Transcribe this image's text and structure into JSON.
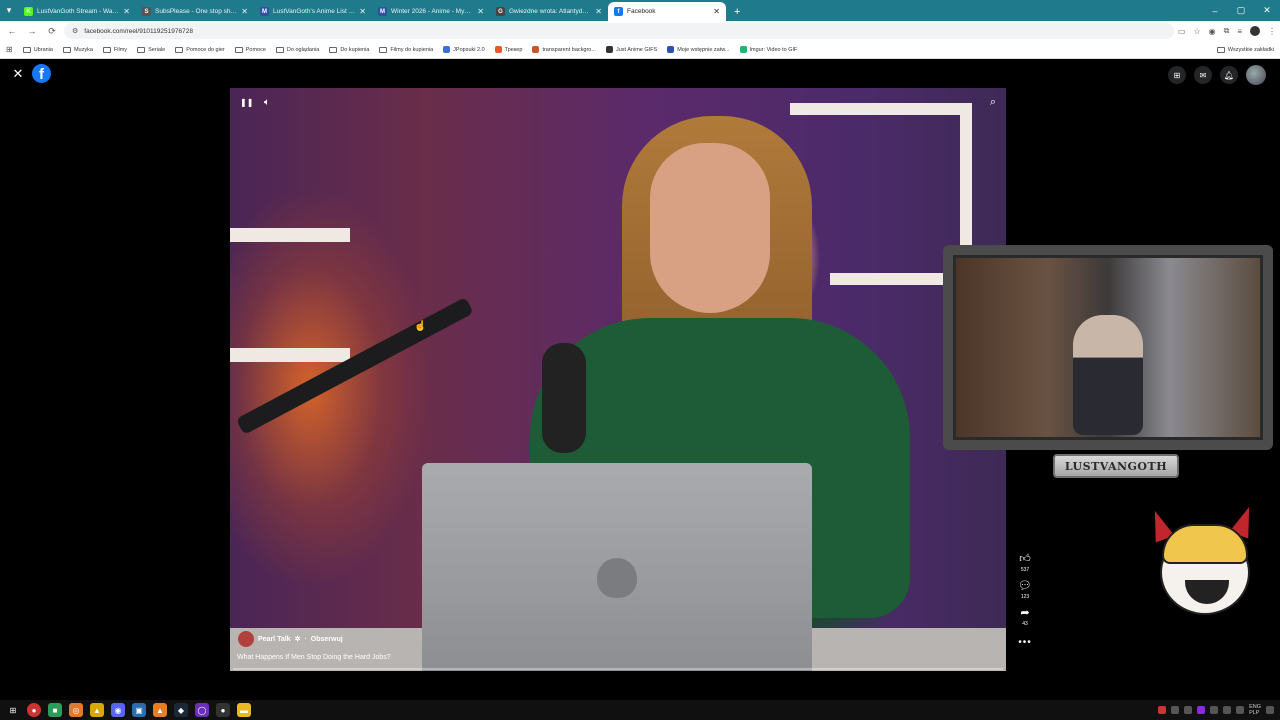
{
  "browser": {
    "tabs": [
      {
        "title": "LustVanGoth Stream - Watch L",
        "favicon_color": "#53fc18",
        "favicon_char": "K",
        "active": false
      },
      {
        "title": "SubsPlease - One stop shop fo",
        "favicon_color": "#555555",
        "favicon_char": "S",
        "active": false
      },
      {
        "title": "LustVanGoth's Anime List - My",
        "favicon_color": "#2e51a2",
        "favicon_char": "M",
        "active": false
      },
      {
        "title": "Winter 2026 - Anime - MyAnim",
        "favicon_color": "#2e51a2",
        "favicon_char": "M",
        "active": false
      },
      {
        "title": "Gwiezdne wrota: Atlantyda / St",
        "favicon_color": "#444444",
        "favicon_char": "G",
        "active": false
      },
      {
        "title": "Facebook",
        "favicon_color": "#1877f2",
        "favicon_char": "f",
        "active": true
      }
    ],
    "url": "facebook.com/reel/910119251976728",
    "bookmarks": [
      {
        "label": "Ubrania",
        "type": "folder"
      },
      {
        "label": "Muzyka",
        "type": "folder"
      },
      {
        "label": "Filmy",
        "type": "folder"
      },
      {
        "label": "Seriale",
        "type": "folder"
      },
      {
        "label": "Pomoce do gier",
        "type": "folder"
      },
      {
        "label": "Pomoce",
        "type": "folder"
      },
      {
        "label": "Do oglądania",
        "type": "folder"
      },
      {
        "label": "Do kupienia",
        "type": "folder"
      },
      {
        "label": "Filmy do kupienia",
        "type": "folder"
      },
      {
        "label": "JPopsuki 2.0",
        "type": "site",
        "color": "#3b6fd8"
      },
      {
        "label": "Трекер",
        "type": "site",
        "color": "#e05a2a"
      },
      {
        "label": "transparent backgro...",
        "type": "site",
        "color": "#c9562b"
      },
      {
        "label": "Just Anime GIFS",
        "type": "site",
        "color": "#333333"
      },
      {
        "label": "Moje wstępnie zatw...",
        "type": "site",
        "color": "#2f4fb5"
      },
      {
        "label": "Imgur: Video to GIF",
        "type": "site",
        "color": "#1bb76e"
      }
    ],
    "bookmarks_right": "Wszystkie zakładki"
  },
  "reel": {
    "author": "Pearl Talk",
    "follow_label": "Obserwuj",
    "separator": "·",
    "title": "What Happens If Men Stop Doing the Hard Jobs?",
    "progress": 0.0,
    "likes": "537",
    "comments": "123",
    "shares": "43"
  },
  "overlay": {
    "streamer_name": "LUSTVANGOTH"
  },
  "taskbar": {
    "lang": "ENG",
    "layout": "PLP"
  },
  "colors": {
    "facebook_blue": "#1877f2",
    "tabstrip": "#1f7a8c"
  },
  "icons": {
    "close": "close-icon",
    "menu": "grid-menu-icon",
    "messenger": "messenger-icon",
    "notifications": "bell-icon"
  }
}
